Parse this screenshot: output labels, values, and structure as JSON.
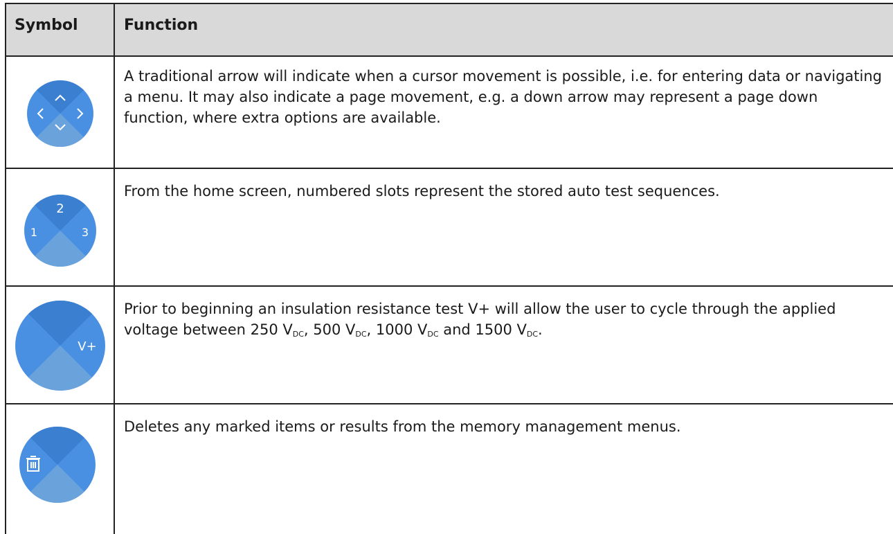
{
  "header": {
    "symbol": "Symbol",
    "function": "Function"
  },
  "rows": [
    {
      "icon": "arrow-dpad-icon",
      "text": "A traditional arrow will indicate when a cursor movement is possible, i.e. for entering data or navigating a menu. It may also indicate a page movement, e.g. a down arrow may represent a page down function, where extra options are available."
    },
    {
      "icon": "numbered-slots-icon",
      "labels": [
        "1",
        "2",
        "3"
      ],
      "text": "From the home screen, numbered slots represent the stored auto test sequences."
    },
    {
      "icon": "voltage-plus-icon",
      "label": "V+",
      "text_parts": {
        "pre": "Prior to beginning an insulation resistance test V+ will allow the user to cycle through the applied voltage between 250 V",
        "sub1": "DC",
        "mid1": ", 500 V",
        "sub2": "DC",
        "mid2": ", 1000 V",
        "sub3": "DC",
        "mid3": " and 1500 V",
        "sub4": "DC",
        "post": "."
      }
    },
    {
      "icon": "trash-icon",
      "text": "Deletes any marked items or results from the memory management menus."
    }
  ],
  "colors": {
    "icon_dark": "#3a7fd0",
    "icon_mid": "#4a90e2",
    "icon_light": "#6aa3dc",
    "header_bg": "#d9d9d9"
  }
}
